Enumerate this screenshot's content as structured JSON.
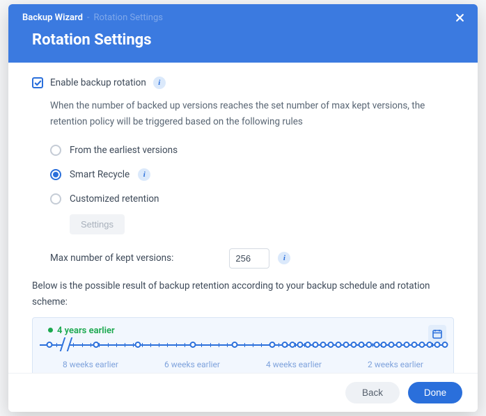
{
  "header": {
    "breadcrumb": {
      "app": "Backup Wizard",
      "sep": "-",
      "step": "Rotation Settings"
    },
    "title": "Rotation Settings"
  },
  "enable": {
    "label": "Enable backup rotation",
    "checked": true,
    "description": "When the number of backed up versions reaches the set number of max kept versions, the retention policy will be triggered based on the following rules"
  },
  "policy": {
    "options": {
      "earliest": "From the earliest versions",
      "smart": "Smart Recycle",
      "custom": "Customized retention"
    },
    "selected": "smart",
    "settings_button": "Settings"
  },
  "max_versions": {
    "label": "Max number of kept versions:",
    "value": "256"
  },
  "result_intro": "Below is the possible result of backup retention according to your backup schedule and rotation scheme:",
  "timeline": {
    "origin_label": "4 years earlier",
    "week_labels": [
      "8 weeks earlier",
      "6 weeks earlier",
      "4 weeks earlier",
      "2 weeks earlier"
    ]
  },
  "footer": {
    "back": "Back",
    "done": "Done"
  },
  "chart_data": {
    "type": "other",
    "description": "Retention timeline showing backup versions kept, from 4 years earlier to present.",
    "early_markers_positions_pct": [
      4,
      15,
      25,
      38,
      48,
      57
    ],
    "recent_cluster_start_pct": 60,
    "recent_cluster_end_pct": 98,
    "recent_cluster_count": 22,
    "axis_break_position_pct": 8,
    "week_labels": [
      "8 weeks earlier",
      "6 weeks earlier",
      "4 weeks earlier",
      "2 weeks earlier"
    ]
  }
}
